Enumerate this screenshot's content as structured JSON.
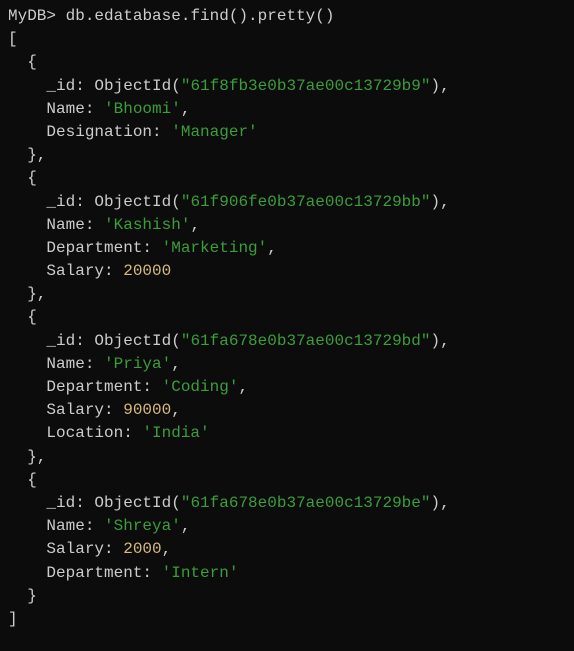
{
  "prompt": "MyDB>",
  "command": "db.edatabase.find().pretty()",
  "open_array": "[",
  "close_array": "]",
  "open_brace": "{",
  "close_brace_comma": "},",
  "close_brace": "}",
  "objectid_label": "ObjectId",
  "documents": [
    {
      "fields": [
        {
          "key": "_id",
          "type": "objectid",
          "value": "\"61f8fb3e0b37ae00c13729b9\"",
          "trailing_comma": true
        },
        {
          "key": "Name",
          "type": "string",
          "value": "'Bhoomi'",
          "trailing_comma": true
        },
        {
          "key": "Designation",
          "type": "string",
          "value": "'Manager'",
          "trailing_comma": false
        }
      ],
      "has_trailing_comma": true
    },
    {
      "fields": [
        {
          "key": "_id",
          "type": "objectid",
          "value": "\"61f906fe0b37ae00c13729bb\"",
          "trailing_comma": true
        },
        {
          "key": "Name",
          "type": "string",
          "value": "'Kashish'",
          "trailing_comma": true
        },
        {
          "key": "Department",
          "type": "string",
          "value": "'Marketing'",
          "trailing_comma": true
        },
        {
          "key": "Salary",
          "type": "number",
          "value": "20000",
          "trailing_comma": false
        }
      ],
      "has_trailing_comma": true
    },
    {
      "fields": [
        {
          "key": "_id",
          "type": "objectid",
          "value": "\"61fa678e0b37ae00c13729bd\"",
          "trailing_comma": true
        },
        {
          "key": "Name",
          "type": "string",
          "value": "'Priya'",
          "trailing_comma": true
        },
        {
          "key": "Department",
          "type": "string",
          "value": "'Coding'",
          "trailing_comma": true
        },
        {
          "key": "Salary",
          "type": "number",
          "value": "90000",
          "trailing_comma": true
        },
        {
          "key": "Location",
          "type": "string",
          "value": "'India'",
          "trailing_comma": false
        }
      ],
      "has_trailing_comma": true
    },
    {
      "fields": [
        {
          "key": "_id",
          "type": "objectid",
          "value": "\"61fa678e0b37ae00c13729be\"",
          "trailing_comma": true
        },
        {
          "key": "Name",
          "type": "string",
          "value": "'Shreya'",
          "trailing_comma": true
        },
        {
          "key": "Salary",
          "type": "number",
          "value": "2000",
          "trailing_comma": true
        },
        {
          "key": "Department",
          "type": "string",
          "value": "'Intern'",
          "trailing_comma": false
        }
      ],
      "has_trailing_comma": false
    }
  ]
}
